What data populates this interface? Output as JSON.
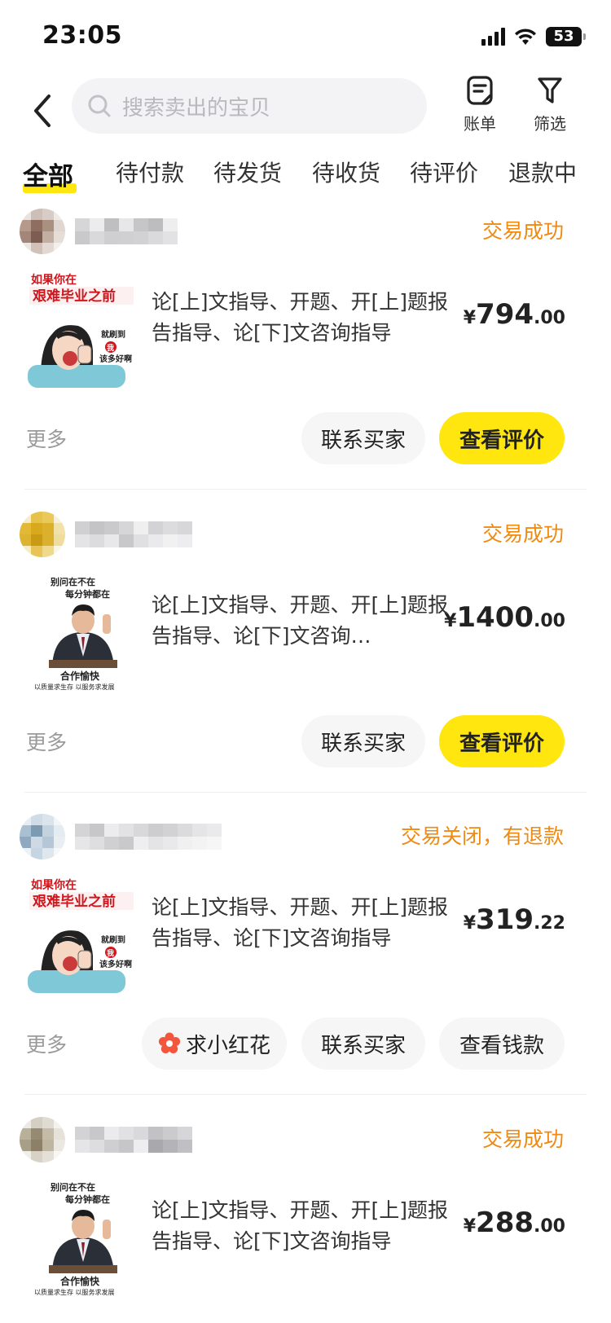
{
  "status_bar": {
    "time": "23:05",
    "battery": "53"
  },
  "header": {
    "search_placeholder": "搜索卖出的宝贝",
    "bill_label": "账单",
    "filter_label": "筛选"
  },
  "tabs": [
    {
      "label": "全部",
      "active": true
    },
    {
      "label": "待付款"
    },
    {
      "label": "待发货"
    },
    {
      "label": "待收货"
    },
    {
      "label": "待评价"
    },
    {
      "label": "退款中"
    }
  ],
  "orders": [
    {
      "status": "交易成功",
      "thumb": "graduation-meme-image",
      "title": "论[上]文指导、开题、开[上]题报告指导、论[下]文咨询指导",
      "price": {
        "currency": "¥",
        "int": "794",
        "dec": ".00"
      },
      "more": "更多",
      "buttons": [
        "联系买家",
        "查看评价"
      ]
    },
    {
      "status": "交易成功",
      "thumb": "businessman-image",
      "title": "论[上]文指导、开题、开[上]题报告指导、论[下]文咨询…",
      "price": {
        "currency": "¥",
        "int": "1400",
        "dec": ".00"
      },
      "more": "更多",
      "buttons": [
        "联系买家",
        "查看评价"
      ]
    },
    {
      "status": "交易关闭，有退款",
      "thumb": "graduation-meme-image",
      "title": "论[上]文指导、开题、开[上]题报告指导、论[下]文咨询指导",
      "price": {
        "currency": "¥",
        "int": "319",
        "dec": ".22"
      },
      "more": "更多",
      "buttons": [
        "求小红花",
        "联系买家",
        "查看钱款"
      ]
    },
    {
      "status": "交易成功",
      "thumb": "businessman-image",
      "title": "论[上]文指导、开题、开[上]题报告指导、论[下]文咨询指导",
      "price": {
        "currency": "¥",
        "int": "288",
        "dec": ".00"
      }
    }
  ],
  "thumb_text": {
    "meme_top": "如果你在",
    "meme_banner": "艰难毕业之前",
    "meme_bubble1": "就刷到",
    "meme_bubble2": "我",
    "meme_bubble3": "该多好啊",
    "biz_top1": "别问在不在",
    "biz_top2": "每分钟都在",
    "biz_bottom1": "合作愉快",
    "biz_bottom2": "以质量求生存 以服务求发展"
  },
  "colors": {
    "accent": "#ffe60f",
    "status": "#ef8a12",
    "muted": "#9a9a9a"
  }
}
